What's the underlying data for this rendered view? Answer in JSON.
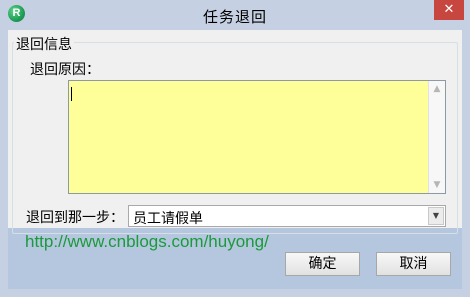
{
  "window": {
    "title": "任务退回",
    "app_icon_letter": "R",
    "close_glyph": "✕"
  },
  "group": {
    "legend": "退回信息"
  },
  "reason": {
    "label": "退回原因：",
    "value": ""
  },
  "step": {
    "label": "退回到那一步：",
    "selected": "员工请假单"
  },
  "watermark": "http://www.cnblogs.com/huyong/",
  "buttons": {
    "ok": "确定",
    "cancel": "取消"
  },
  "icons": {
    "scroll_up": "chevron-up-icon",
    "scroll_down": "chevron-down-icon",
    "dropdown": "dropdown-arrow-icon"
  }
}
